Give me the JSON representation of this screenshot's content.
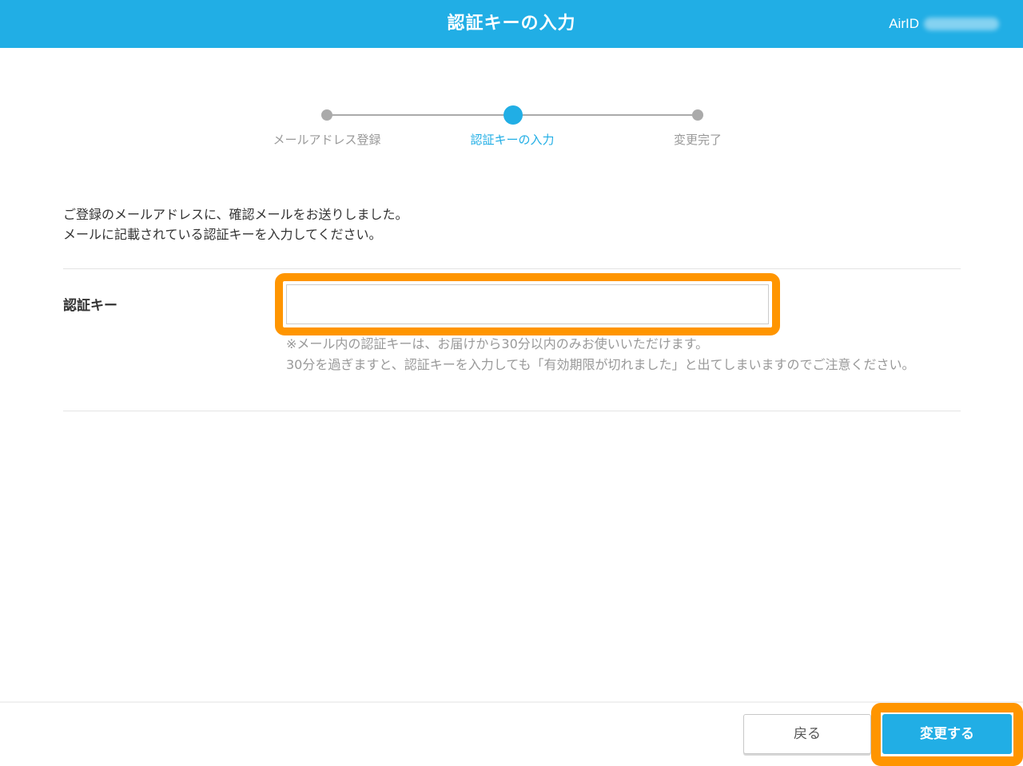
{
  "header": {
    "title": "認証キーの入力",
    "user_label": "AirID"
  },
  "stepper": {
    "steps": [
      {
        "label": "メールアドレス登録",
        "state": "done"
      },
      {
        "label": "認証キーの入力",
        "state": "current"
      },
      {
        "label": "変更完了",
        "state": "pending"
      }
    ]
  },
  "intro": {
    "line1": "ご登録のメールアドレスに、確認メールをお送りしました。",
    "line2": "メールに記載されている認証キーを入力してください。"
  },
  "form": {
    "auth_key_label": "認証キー",
    "auth_key_value": "",
    "note_line1": "※メール内の認証キーは、お届けから30分以内のみお使いいただけます。",
    "note_line2": "30分を過ぎますと、認証キーを入力しても「有効期限が切れました」と出てしまいますのでご注意ください。"
  },
  "footer": {
    "back_label": "戻る",
    "submit_label": "変更する"
  },
  "colors": {
    "brand": "#21aee5",
    "highlight": "#ff9500",
    "step_inactive": "#aaaaaa",
    "note_text": "#999999"
  }
}
